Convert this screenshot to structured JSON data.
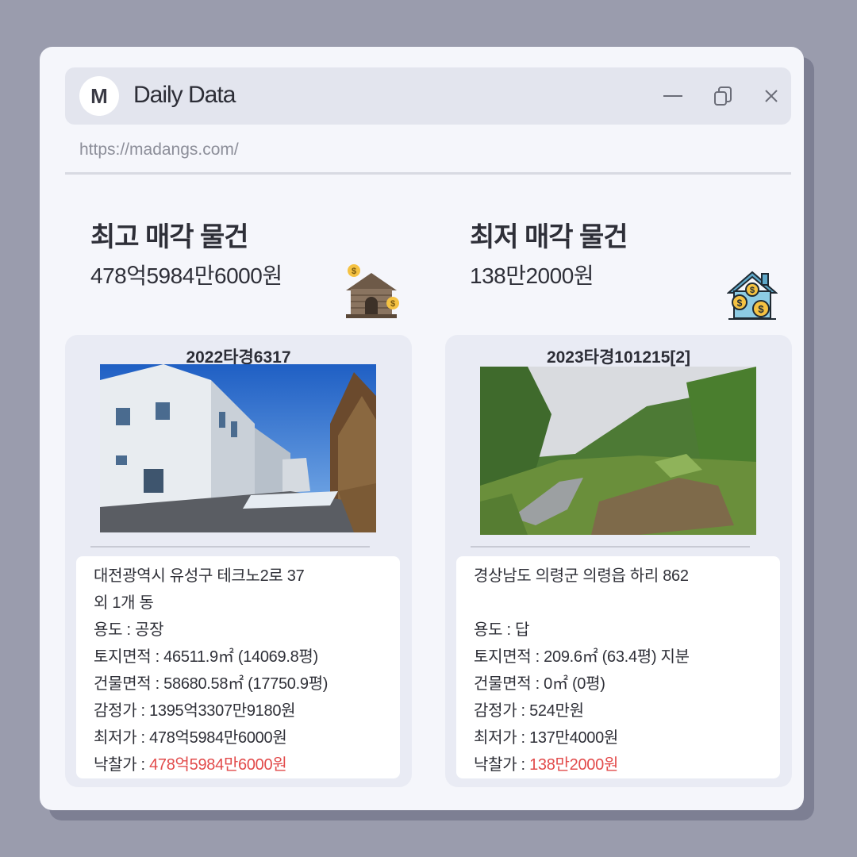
{
  "window": {
    "avatar_letter": "M",
    "title": "Daily Data",
    "url": "https://madangs.com/"
  },
  "sections": {
    "highest": {
      "title": "최고 매각 물건",
      "price": "478억5984만6000원",
      "icon": "house-money-icon"
    },
    "lowest": {
      "title": "최저 매각 물건",
      "price": "138만2000원",
      "icon": "house-coins-icon"
    }
  },
  "cards": {
    "left": {
      "case_no": "2022타경6317",
      "address1": "대전광역시 유성구 테크노2로 37",
      "address2": "외 1개 동",
      "usage": "용도 : 공장",
      "land_area": "토지면적 : 46511.9㎡ (14069.8평)",
      "building_area": "건물면적 : 58680.58㎡ (17750.9평)",
      "appraisal": "감정가 : 1395억3307만9180원",
      "minimum": "최저가 : 478억5984만6000원",
      "winning_label": "낙찰가 : ",
      "winning_value": "478억5984만6000원"
    },
    "right": {
      "case_no": "2023타경101215[2]",
      "address1": "경상남도 의령군 의령읍 하리 862",
      "address2": "",
      "usage": "용도 : 답",
      "land_area": "토지면적 : 209.6㎡ (63.4평) 지분",
      "building_area": "건물면적 : 0㎡ (0평)",
      "appraisal": "감정가 :  524만원",
      "minimum": "최저가 : 137만4000원",
      "winning_label": "낙찰가 : ",
      "winning_value": "138만2000원"
    }
  },
  "colors": {
    "background": "#9a9cad",
    "window": "#f5f6fb",
    "titlebar": "#e3e5ee",
    "card": "#e9ebf4",
    "highlight": "#e24b4b"
  }
}
